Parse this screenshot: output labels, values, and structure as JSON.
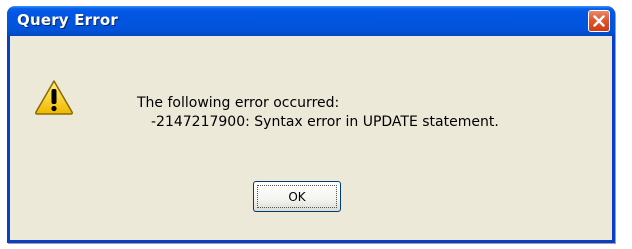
{
  "dialog": {
    "title": "Query Error",
    "icon": "warning-icon",
    "message_line1": "The following error occurred:",
    "message_line2": "-2147217900: Syntax error in UPDATE statement.",
    "ok_label": "OK"
  },
  "colors": {
    "titlebar": "#0255de",
    "window_bg": "#ece9d8",
    "close_button": "#e2562e",
    "warning_yellow": "#f7d117"
  }
}
